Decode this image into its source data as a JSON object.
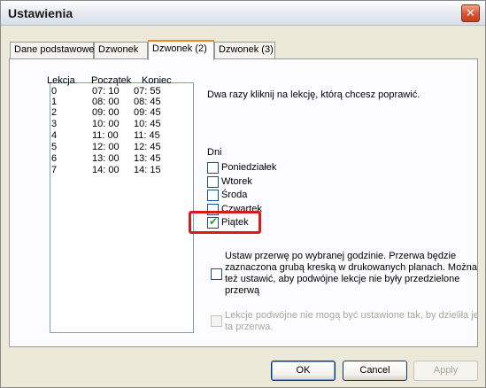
{
  "window": {
    "title": "Ustawienia",
    "close_symbol": "✕"
  },
  "tabs": [
    {
      "label": "Dane podstawowe",
      "active": false
    },
    {
      "label": "Dzwonek",
      "active": false
    },
    {
      "label": "Dzwonek (2)",
      "active": true
    },
    {
      "label": "Dzwonek (3)",
      "active": false
    }
  ],
  "lessons": {
    "headers": [
      "Lekcja",
      "Początek",
      "Koniec"
    ],
    "rows": [
      {
        "lesson": "0",
        "start": "07: 10",
        "end": "07: 55"
      },
      {
        "lesson": "1",
        "start": "08: 00",
        "end": "08: 45"
      },
      {
        "lesson": "2",
        "start": "09: 00",
        "end": "09: 45"
      },
      {
        "lesson": "3",
        "start": "10: 00",
        "end": "10: 45"
      },
      {
        "lesson": "4",
        "start": "11: 00",
        "end": "11: 45"
      },
      {
        "lesson": "5",
        "start": "12: 00",
        "end": "12: 45"
      },
      {
        "lesson": "6",
        "start": "13: 00",
        "end": "13: 45"
      },
      {
        "lesson": "7",
        "start": "14: 00",
        "end": "14: 15"
      }
    ]
  },
  "hint": "Dwa razy kliknij na lekcję, którą chcesz poprawić.",
  "days": {
    "label": "Dni",
    "items": [
      {
        "label": "Poniedziałek",
        "checked": false
      },
      {
        "label": "Wtorek",
        "checked": false
      },
      {
        "label": "Środa",
        "checked": false
      },
      {
        "label": "Czwartek",
        "checked": false
      },
      {
        "label": "Piątek",
        "checked": true
      }
    ],
    "check_symbol": "✔"
  },
  "break_option": {
    "text": "Ustaw przerwę po wybranej godzinie. Przerwa będzie zaznaczona grubą kreską w drukowanych planach. Można też ustawić, aby podwójne lekcje nie były przedzielone przerwą",
    "checked": false
  },
  "double_lessons_option": {
    "text": "Lekcje podwójne nie mogą być ustawione tak, by dzieliła je ta przerwa.",
    "checked": false,
    "disabled": true
  },
  "buttons": {
    "ok": "OK",
    "cancel": "Cancel",
    "apply": "Apply"
  },
  "colors": {
    "highlight": "#d81a1a",
    "active_tab_accent": "#e68b2c",
    "check": "#21a121"
  }
}
